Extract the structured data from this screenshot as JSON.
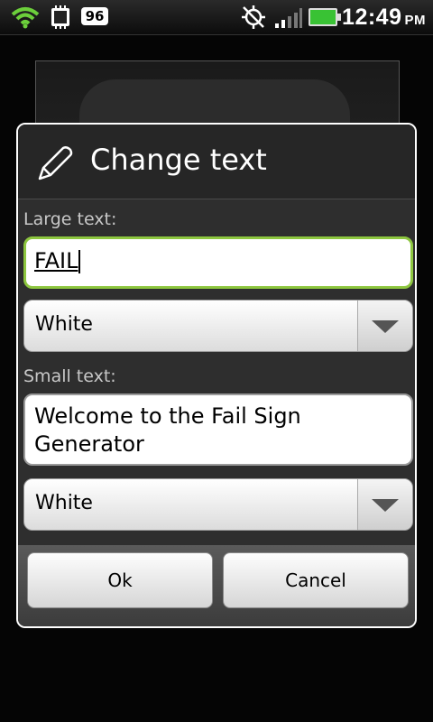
{
  "status_bar": {
    "battery_percent": "96",
    "time": "12:49",
    "ampm": "PM"
  },
  "dialog": {
    "title": "Change text",
    "large_text_label": "Large text:",
    "large_text_value": "FAIL",
    "large_text_color": "White",
    "small_text_label": "Small text:",
    "small_text_value": "Welcome to the Fail Sign Generator",
    "small_text_color": "White",
    "ok_label": "Ok",
    "cancel_label": "Cancel"
  },
  "colors": {
    "focus_accent": "#8dc63f",
    "battery_green": "#39c234"
  }
}
